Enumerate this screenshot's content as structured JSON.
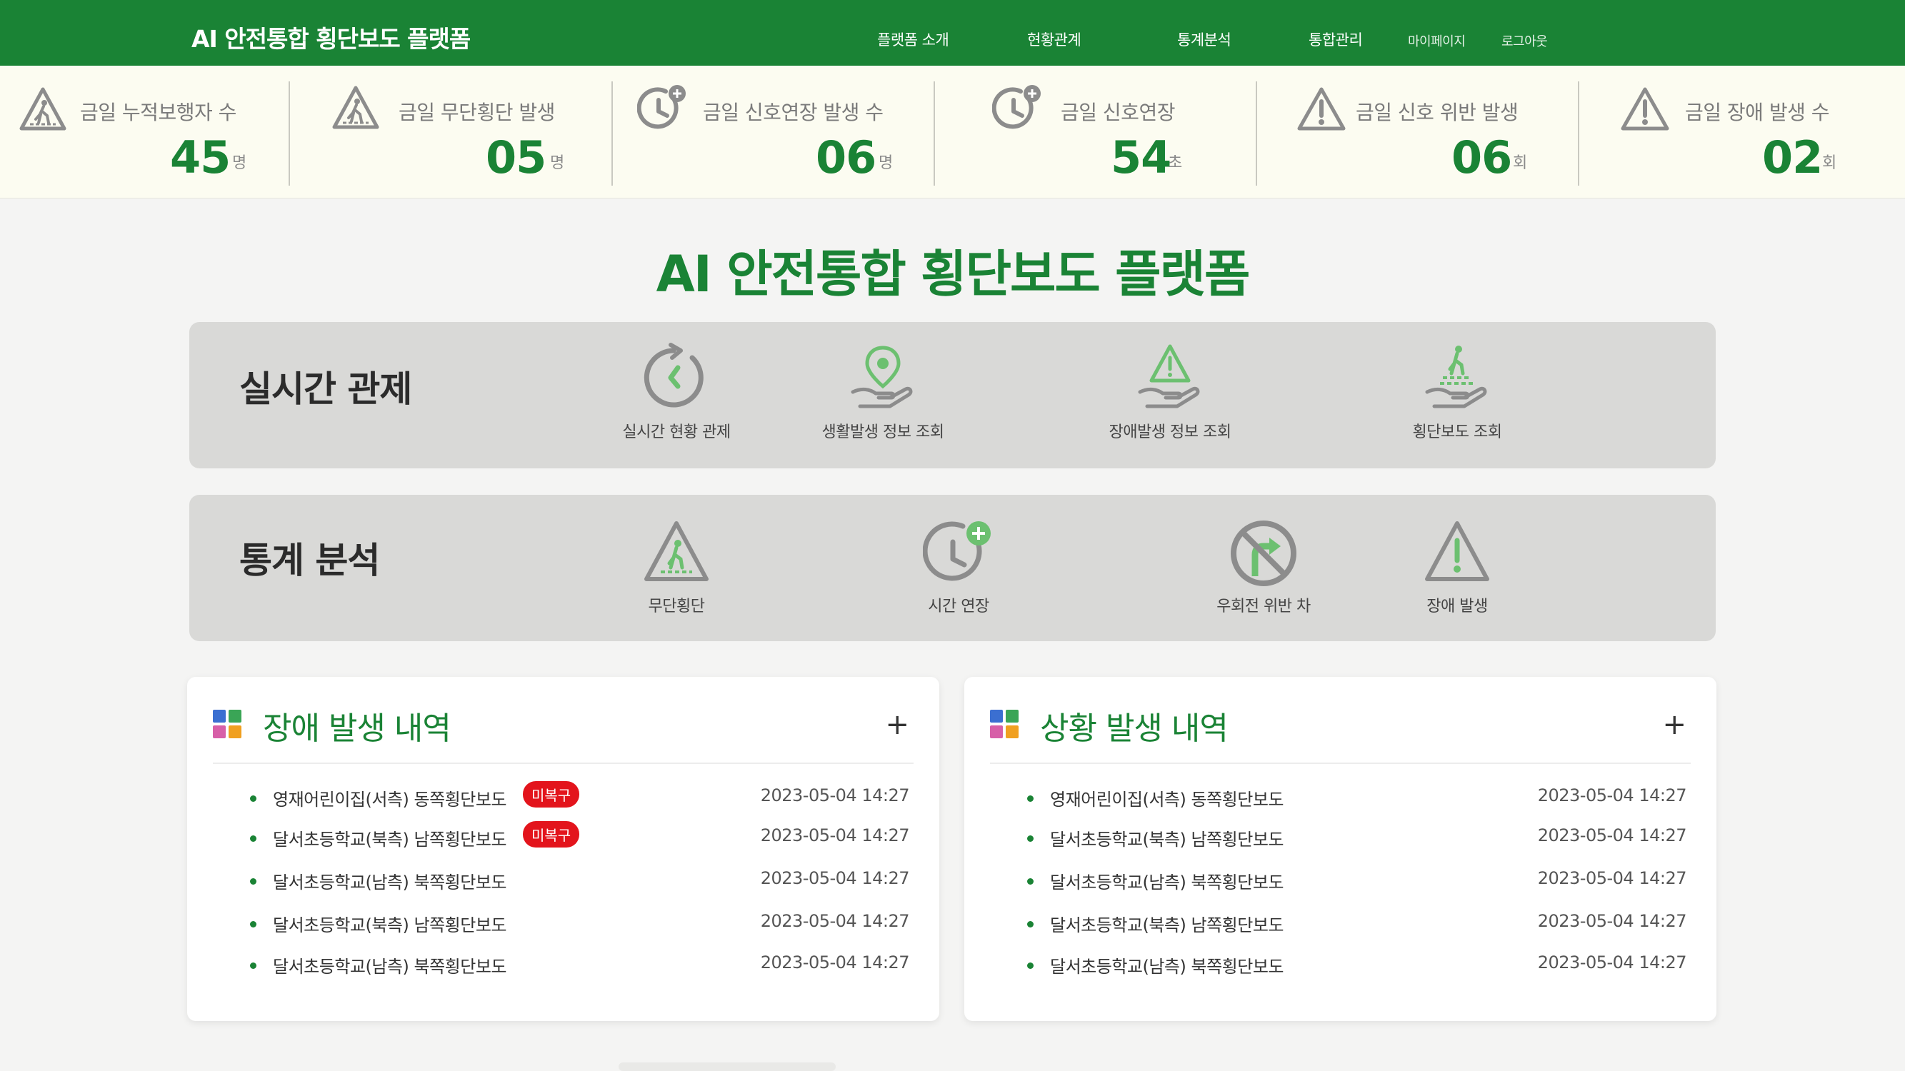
{
  "header": {
    "brand": "AI 안전통합 횡단보도 플랫폼",
    "nav": [
      "플랫폼 소개",
      "현황관계",
      "통계분석",
      "통합관리"
    ],
    "mypage": "마이페이지",
    "logout": "로그아웃"
  },
  "stats": [
    {
      "label": "금일 누적보행자 수",
      "value": "45",
      "unit": "명",
      "icon": "crosswalk-warning-icon"
    },
    {
      "label": "금일 무단횡단 발생",
      "value": "05",
      "unit": "명",
      "icon": "crosswalk-warning-icon"
    },
    {
      "label": "금일 신호연장 발생 수",
      "value": "06",
      "unit": "명",
      "icon": "clock-plus-icon"
    },
    {
      "label": "금일 신호연장",
      "value": "54",
      "unit": "초",
      "icon": "clock-plus-icon"
    },
    {
      "label": "금일 신호 위반 발생",
      "value": "06",
      "unit": "회",
      "icon": "warning-icon"
    },
    {
      "label": "금일 장애 발생 수",
      "value": "02",
      "unit": "회",
      "icon": "warning-icon"
    }
  ],
  "main_title": "AI 안전통합 횡단보도 플랫폼",
  "realtime": {
    "title": "실시간 관제",
    "items": [
      {
        "label": "실시간 현황 관제",
        "icon": "realtime-refresh-icon"
      },
      {
        "label": "생활발생 정보 조회",
        "icon": "location-hand-icon"
      },
      {
        "label": "장애발생 정보 조회",
        "icon": "warning-hand-icon"
      },
      {
        "label": "횡단보도 조회",
        "icon": "crosswalk-hand-icon"
      }
    ]
  },
  "statistics": {
    "title": "통계 분석",
    "items": [
      {
        "label": "무단횡단",
        "icon": "crosswalk-warning-icon"
      },
      {
        "label": "시간 연장",
        "icon": "clock-plus-icon"
      },
      {
        "label": "우회전 위반 차",
        "icon": "no-right-turn-icon"
      },
      {
        "label": "장애 발생",
        "icon": "warning-icon"
      }
    ]
  },
  "fault_card": {
    "title": "장애 발생 내역",
    "more": "+",
    "items": [
      {
        "name": "영재어린이집(서측) 동쪽횡단보도",
        "badge": "미복구",
        "date": "2023-05-04 14:27"
      },
      {
        "name": "달서초등학교(북측) 남쪽횡단보도",
        "badge": "미복구",
        "date": "2023-05-04 14:27"
      },
      {
        "name": "달서초등학교(남측) 북쪽횡단보도",
        "badge": "",
        "date": "2023-05-04 14:27"
      },
      {
        "name": "달서초등학교(북측) 남쪽횡단보도",
        "badge": "",
        "date": "2023-05-04 14:27"
      },
      {
        "name": "달서초등학교(남측) 북쪽횡단보도",
        "badge": "",
        "date": "2023-05-04 14:27"
      }
    ]
  },
  "situation_card": {
    "title": "상황 발생 내역",
    "more": "+",
    "items": [
      {
        "name": "영재어린이집(서측) 동쪽횡단보도",
        "date": "2023-05-04 14:27"
      },
      {
        "name": "달서초등학교(북측) 남쪽횡단보도",
        "date": "2023-05-04 14:27"
      },
      {
        "name": "달서초등학교(남측) 북쪽횡단보도",
        "date": "2023-05-04 14:27"
      },
      {
        "name": "달서초등학교(북측) 남쪽횡단보도",
        "date": "2023-05-04 14:27"
      },
      {
        "name": "달서초등학교(남측) 북쪽횡단보도",
        "date": "2023-05-04 14:27"
      }
    ]
  },
  "colors": {
    "brand": "#1a8335",
    "stats_bg": "#fcfcf1",
    "panel_bg": "#d9d9d7",
    "badge": "#e3141c",
    "icon_gray": "#8c8c8c",
    "icon_green": "#6cc070"
  }
}
